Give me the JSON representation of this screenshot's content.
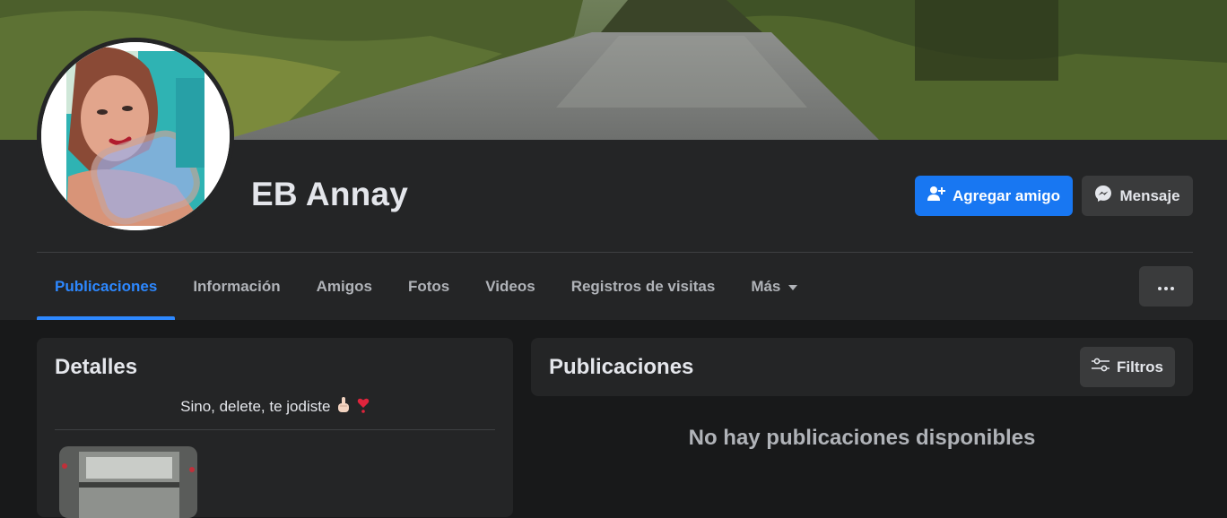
{
  "profile": {
    "name": "EB Annay",
    "add_friend_label": "Agregar amigo",
    "message_label": "Mensaje"
  },
  "tabs": [
    {
      "label": "Publicaciones",
      "active": true
    },
    {
      "label": "Información",
      "active": false
    },
    {
      "label": "Amigos",
      "active": false
    },
    {
      "label": "Fotos",
      "active": false
    },
    {
      "label": "Videos",
      "active": false
    },
    {
      "label": "Registros de visitas",
      "active": false
    },
    {
      "label": "Más",
      "active": false
    }
  ],
  "details": {
    "title": "Detalles",
    "bio": "Sino, delete, te jodiste"
  },
  "posts": {
    "title": "Publicaciones",
    "filter_label": "Filtros",
    "empty_message": "No hay publicaciones disponibles"
  },
  "icons": {
    "add_friend": "person-plus-icon",
    "message": "messenger-icon",
    "more_tab": "caret-down-icon",
    "more_actions": "ellipsis-icon",
    "filters": "sliders-icon"
  },
  "colors": {
    "background": "#18191a",
    "surface": "#242526",
    "button_secondary": "#3a3b3c",
    "accent": "#1877f2",
    "active_tab": "#2d88ff",
    "text_primary": "#e4e6eb",
    "text_secondary": "#b0b3b8"
  }
}
